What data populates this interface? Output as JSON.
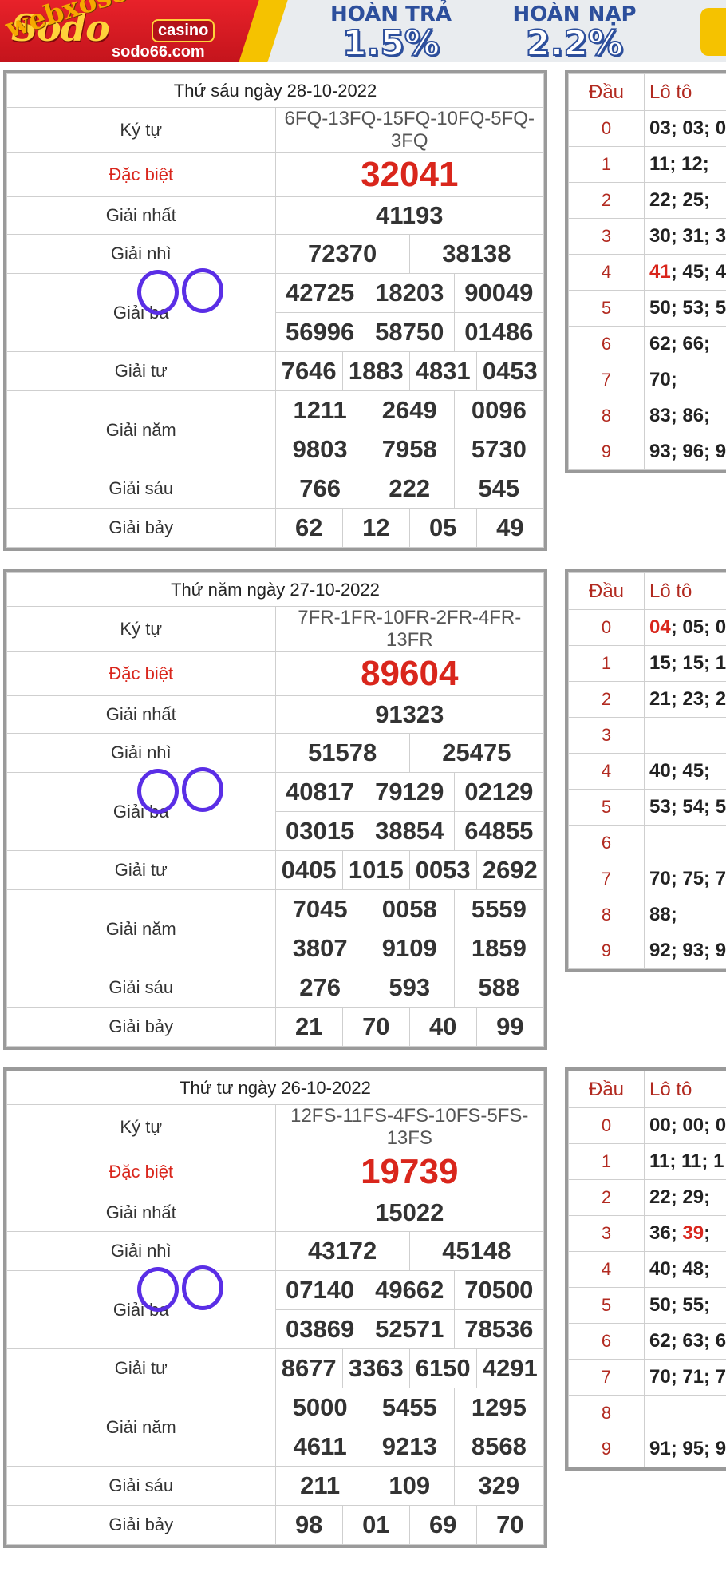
{
  "banner": {
    "logo": "Sodo",
    "casino": "casino",
    "site": "sodo66.com",
    "watermark": "webxoso.net",
    "promo1_title": "HOÀN TRẢ",
    "promo1_value": "1.5%",
    "promo2_title": "HOÀN NẠP",
    "promo2_value": "2.2%"
  },
  "labels": {
    "kytu": "Ký tự",
    "dacbiet": "Đặc biệt",
    "nhat": "Giải nhất",
    "nhi": "Giải nhì",
    "ba": "Giải ba",
    "tu": "Giải tư",
    "nam": "Giải năm",
    "sau": "Giải sáu",
    "bay": "Giải bảy",
    "dau": "Đầu",
    "loto": "Lô tô"
  },
  "draws": [
    {
      "date": "Thứ sáu ngày 28-10-2022",
      "kytu": "6FQ-13FQ-15FQ-10FQ-5FQ-3FQ",
      "dacbiet": "32041",
      "nhat": "41193",
      "nhi": [
        "72370",
        "38138"
      ],
      "ba": [
        "42725",
        "18203",
        "90049",
        "56996",
        "58750",
        "01486"
      ],
      "tu": [
        "7646",
        "1883",
        "4831",
        "0453"
      ],
      "nam": [
        "1211",
        "2649",
        "0096",
        "9803",
        "7958",
        "5730"
      ],
      "sau": [
        "766",
        "222",
        "545"
      ],
      "bay": [
        "62",
        "12",
        "05",
        "49"
      ],
      "loto": [
        "03; 03; 0",
        "11; 12;",
        "22; 25;",
        "30; 31; 3",
        "41",
        "50; 53; 5",
        "62; 66;",
        "70;",
        "83; 86;",
        "93; 96; 9"
      ],
      "loto4_rest": "; 45; 4"
    },
    {
      "date": "Thứ năm ngày 27-10-2022",
      "kytu": "7FR-1FR-10FR-2FR-4FR-13FR",
      "dacbiet": "89604",
      "nhat": "91323",
      "nhi": [
        "51578",
        "25475"
      ],
      "ba": [
        "40817",
        "79129",
        "02129",
        "03015",
        "38854",
        "64855"
      ],
      "tu": [
        "0405",
        "1015",
        "0053",
        "2692"
      ],
      "nam": [
        "7045",
        "0058",
        "5559",
        "3807",
        "9109",
        "1859"
      ],
      "sau": [
        "276",
        "593",
        "588"
      ],
      "bay": [
        "21",
        "70",
        "40",
        "99"
      ],
      "loto": [
        "04",
        "15; 15; 1",
        "21; 23; 2",
        "",
        "40; 45;",
        "53; 54; 5",
        "",
        "70; 75; 7",
        "88;",
        "92; 93; 9"
      ],
      "loto0_rest": "; 05; 0"
    },
    {
      "date": "Thứ tư ngày 26-10-2022",
      "kytu": "12FS-11FS-4FS-10FS-5FS-13FS",
      "dacbiet": "19739",
      "nhat": "15022",
      "nhi": [
        "43172",
        "45148"
      ],
      "ba": [
        "07140",
        "49662",
        "70500",
        "03869",
        "52571",
        "78536"
      ],
      "tu": [
        "8677",
        "3363",
        "6150",
        "4291"
      ],
      "nam": [
        "5000",
        "5455",
        "1295",
        "4611",
        "9213",
        "8568"
      ],
      "sau": [
        "211",
        "109",
        "329"
      ],
      "bay": [
        "98",
        "01",
        "69",
        "70"
      ],
      "loto": [
        "00; 00; 0",
        "11; 11; 1",
        "22; 29;",
        "36; ",
        "40; 48;",
        "50; 55;",
        "62; 63; 6",
        "70; 71; 7",
        "",
        "91; 95; 9"
      ],
      "loto3_hl": "39",
      "loto3_rest": ";"
    }
  ],
  "dau_digits": [
    "0",
    "1",
    "2",
    "3",
    "4",
    "5",
    "6",
    "7",
    "8",
    "9"
  ]
}
